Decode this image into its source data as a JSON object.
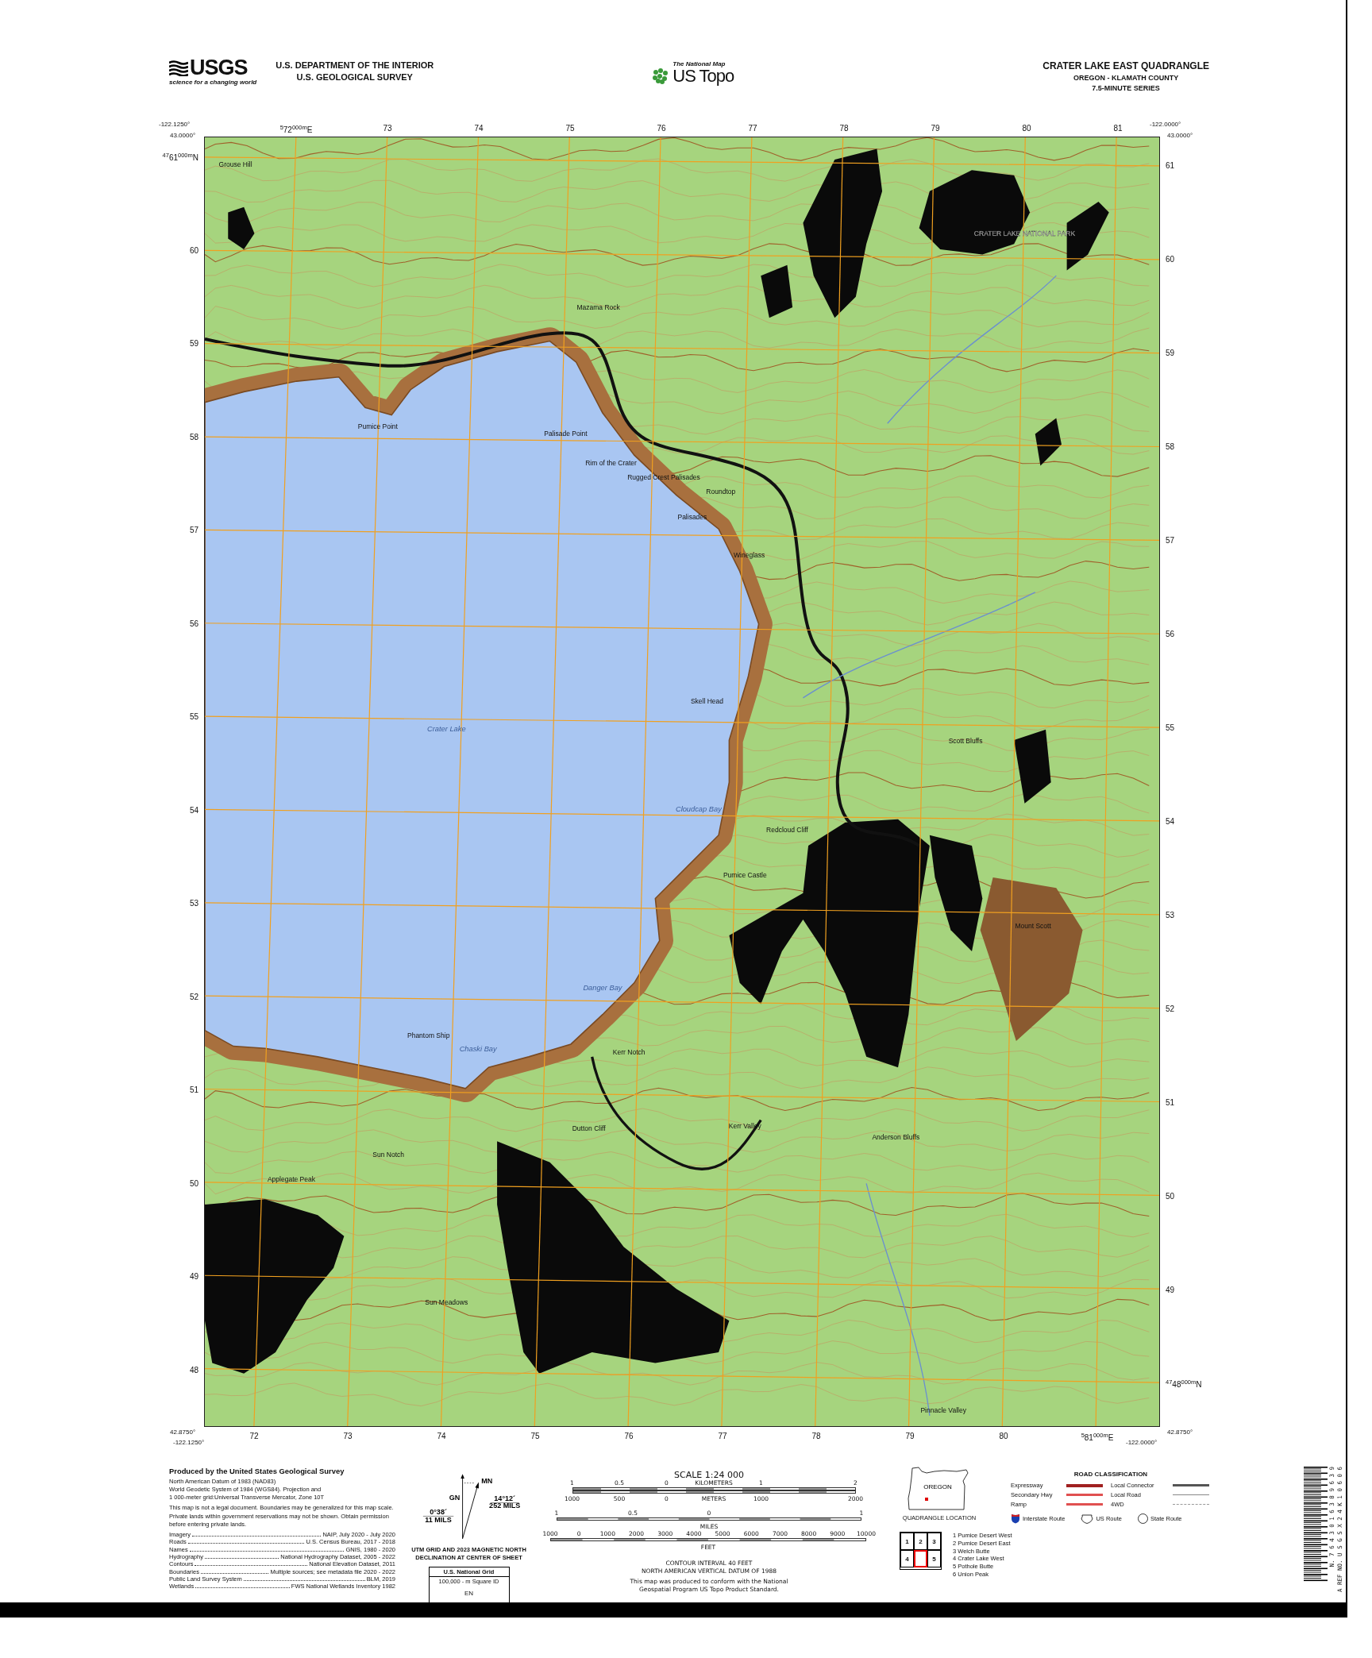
{
  "header": {
    "agency_logo_text": "USGS",
    "agency_tagline": "science for a changing world",
    "department": "U.S. DEPARTMENT OF THE INTERIOR",
    "survey": "U.S. GEOLOGICAL SURVEY",
    "product_kicker": "The National Map",
    "product_name": "US Topo",
    "title": "CRATER LAKE EAST QUADRANGLE",
    "subtitle": "OREGON - KLAMATH COUNTY",
    "series": "7.5-MINUTE SERIES"
  },
  "map": {
    "corners": {
      "top_left_lon": "-122.1250°",
      "top_left_lat": "43.0000°",
      "top_right_lon": "-122.0000°",
      "top_right_lat": "43.0000°",
      "bottom_left_lat": "42.8750°",
      "bottom_left_lon": "-122.1250°",
      "bottom_right_lon": "-122.0000°",
      "bottom_right_lat": "42.8750°"
    },
    "top_ticks": [
      "$^{5}$72$^{000m}$E",
      "73",
      "74",
      "75",
      "76",
      "77",
      "78",
      "79",
      "80",
      "81"
    ],
    "bottom_ticks": [
      "72",
      "73",
      "74",
      "75",
      "76",
      "77",
      "78",
      "79",
      "80",
      "$^{5}$81$^{000m}$E"
    ],
    "left_ticks": [
      "$^{47}$61$^{000m}$N",
      "60",
      "59",
      "58",
      "57",
      "56",
      "55",
      "54",
      "53",
      "52",
      "51",
      "50",
      "49",
      "48"
    ],
    "right_ticks": [
      "61",
      "60",
      "59",
      "58",
      "57",
      "56",
      "55",
      "54",
      "53",
      "52",
      "51",
      "50",
      "49",
      "$^{47}$48$^{000m}$N"
    ],
    "labels": [
      {
        "text": "Grouse Hill",
        "kind": "land"
      },
      {
        "text": "CRATER LAKE NATIONAL PARK",
        "kind": "park"
      },
      {
        "text": "Mazama Rock",
        "kind": "land"
      },
      {
        "text": "Pumice Point",
        "kind": "land"
      },
      {
        "text": "Palisade Point",
        "kind": "land"
      },
      {
        "text": "Rim of the Crater",
        "kind": "land"
      },
      {
        "text": "Rugged Crest Palisades",
        "kind": "land"
      },
      {
        "text": "Roundtop",
        "kind": "land"
      },
      {
        "text": "Palisades",
        "kind": "land"
      },
      {
        "text": "Wineglass",
        "kind": "land"
      },
      {
        "text": "Skell Head",
        "kind": "land"
      },
      {
        "text": "Crater Lake",
        "kind": "water"
      },
      {
        "text": "Scott Bluffs",
        "kind": "land"
      },
      {
        "text": "Cloudcap Bay",
        "kind": "water"
      },
      {
        "text": "Redcloud Cliff",
        "kind": "land"
      },
      {
        "text": "Pumice Castle",
        "kind": "land"
      },
      {
        "text": "Mount Scott",
        "kind": "land"
      },
      {
        "text": "Danger Bay",
        "kind": "water"
      },
      {
        "text": "Kerr Notch",
        "kind": "land"
      },
      {
        "text": "Phantom Ship",
        "kind": "land"
      },
      {
        "text": "Chaski Bay",
        "kind": "water"
      },
      {
        "text": "Dutton Cliff",
        "kind": "land"
      },
      {
        "text": "Kerr Valley",
        "kind": "land"
      },
      {
        "text": "Anderson Bluffs",
        "kind": "land"
      },
      {
        "text": "Sun Notch",
        "kind": "land"
      },
      {
        "text": "Applegate Peak",
        "kind": "land"
      },
      {
        "text": "Sun Meadows",
        "kind": "land"
      },
      {
        "text": "Pinnacle Valley",
        "kind": "land"
      }
    ]
  },
  "credits": {
    "title": "Produced by the United States Geological Survey",
    "datum": "North American Datum of 1983 (NAD83)\nWorld Geodetic System of 1984 (WGS84).  Projection and\n1 000-meter grid:Universal Transverse Mercator, Zone 10T",
    "disclaimer": "This map is not a legal document. Boundaries may be generalized for this map scale. Private lands within government reservations may not be shown. Obtain permission before entering private lands.",
    "sources": [
      {
        "label": "Imagery",
        "value": "NAIP, July 2020 - July 2020"
      },
      {
        "label": "Roads",
        "value": "U.S. Census Bureau, 2017 - 2018"
      },
      {
        "label": "Names",
        "value": "GNIS, 1980 - 2020"
      },
      {
        "label": "Hydrography",
        "value": "National Hydrography Dataset, 2005 - 2022"
      },
      {
        "label": "Contours",
        "value": "National Elevation Dataset, 2011"
      },
      {
        "label": "Boundaries",
        "value": "Multiple sources; see metadata file 2020 - 2022"
      },
      {
        "label": "Public Land Survey System",
        "value": "BLM, 2019"
      },
      {
        "label": "Wetlands",
        "value": "FWS National Wetlands Inventory 1982"
      }
    ]
  },
  "declination": {
    "magnetic_label": "MN",
    "grid_label": "GN",
    "magnetic_angle": "14°12´",
    "magnetic_mils": "252 MILS",
    "grid_angle": "0°38´",
    "grid_mils": "11 MILS",
    "caption": "UTM GRID AND 2023 MAGNETIC NORTH DECLINATION AT CENTER OF SHEET",
    "national_grid": {
      "title": "U.S. National Grid",
      "subtitle": "100,000 - m Square ID",
      "square_id": "EN"
    }
  },
  "scale": {
    "title": "SCALE 1:24 000",
    "kilometers": {
      "ticks": [
        "1",
        "0.5",
        "0",
        "1",
        "2"
      ],
      "unit": "KILOMETERS"
    },
    "meters": {
      "ticks": [
        "1000",
        "500",
        "0",
        "1000",
        "2000"
      ],
      "unit": "METERS"
    },
    "miles": {
      "ticks": [
        "1",
        "0.5",
        "0",
        "1"
      ],
      "unit": "MILES"
    },
    "feet": {
      "ticks": [
        "1000",
        "0",
        "1000",
        "2000",
        "3000",
        "4000",
        "5000",
        "6000",
        "7000",
        "8000",
        "9000",
        "10000"
      ],
      "unit": "FEET"
    },
    "contour_interval": "CONTOUR INTERVAL 40 FEET",
    "vertical_datum": "NORTH AMERICAN VERTICAL DATUM OF 1988",
    "standard_note": "This map was produced to conform with the National Geospatial Program US Topo Product Standard."
  },
  "location": {
    "state": "OREGON",
    "caption": "QUADRANGLE LOCATION"
  },
  "road_classification": {
    "title": "ROAD CLASSIFICATION",
    "items": [
      {
        "label": "Expressway",
        "kind": "expressway"
      },
      {
        "label": "Local Connector",
        "kind": "local_connector"
      },
      {
        "label": "Secondary Hwy",
        "kind": "secondary"
      },
      {
        "label": "Local Road",
        "kind": "local_road"
      },
      {
        "label": "Ramp",
        "kind": "ramp"
      },
      {
        "label": "4WD",
        "kind": "fourwheel"
      }
    ],
    "shields": [
      {
        "label": "Interstate Route",
        "kind": "interstate"
      },
      {
        "label": "US Route",
        "kind": "us"
      },
      {
        "label": "State Route",
        "kind": "state"
      }
    ]
  },
  "adjacent": {
    "cells": [
      "1",
      "2",
      "3",
      "4",
      "5"
    ],
    "names": [
      "1 Pumice Desert West",
      "2 Pumice Desert East",
      "3 Welch Butte",
      "4 Crater Lake West",
      "5 Pothole Butte",
      "6 Union Peak"
    ]
  },
  "barcode": {
    "isbn": "N. 7 6 4 3 0 1 6 3 8 9 6 3 9",
    "ref": "A REF NO. U S G S X 2 4 K 1 0 6 0 6"
  }
}
